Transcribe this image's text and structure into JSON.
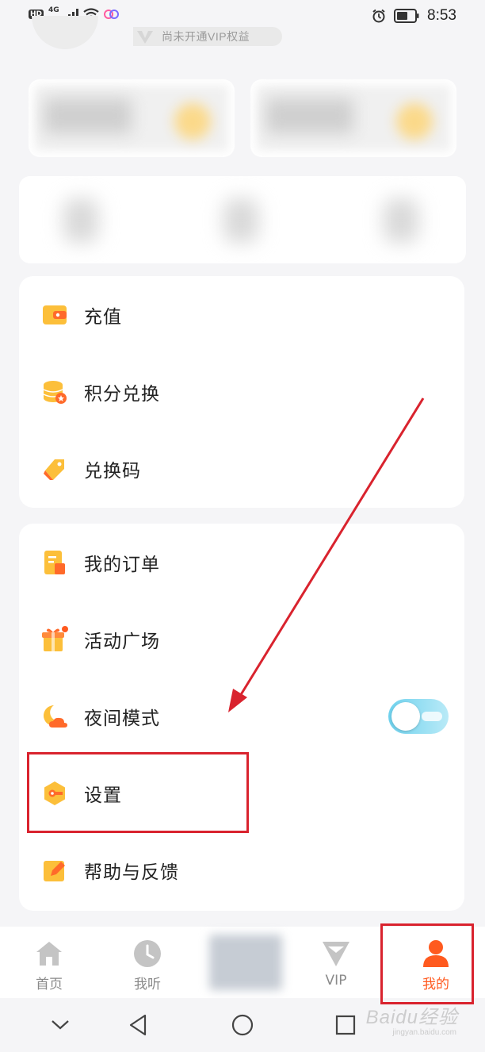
{
  "status_bar": {
    "hd": "HD",
    "network": "4G",
    "time": "8:53",
    "icons": [
      "signal-icon",
      "wifi-icon",
      "app-notification-icon",
      "alarm-icon",
      "battery-icon"
    ]
  },
  "header": {
    "vip_text": "尚未开通VIP权益"
  },
  "menu_group_1": [
    {
      "label": "充值",
      "icon": "wallet-icon"
    },
    {
      "label": "积分兑换",
      "icon": "coins-icon"
    },
    {
      "label": "兑换码",
      "icon": "tag-icon"
    }
  ],
  "menu_group_2": [
    {
      "label": "我的订单",
      "icon": "order-icon"
    },
    {
      "label": "活动广场",
      "icon": "gift-icon",
      "badge": true
    },
    {
      "label": "夜间模式",
      "icon": "moon-icon",
      "toggle": "off"
    },
    {
      "label": "设置",
      "icon": "settings-icon"
    },
    {
      "label": "帮助与反馈",
      "icon": "edit-icon"
    }
  ],
  "bottom_nav": [
    {
      "label": "首页",
      "icon": "home-icon",
      "active": false
    },
    {
      "label": "我听",
      "icon": "clock-icon",
      "active": false
    },
    {
      "label": "VIP",
      "icon": "vip-icon",
      "active": false
    },
    {
      "label": "我的",
      "icon": "profile-icon",
      "active": true
    }
  ],
  "colors": {
    "accent": "#ff5a1f",
    "icon_yellow": "#fcbf3a",
    "icon_orange": "#ff6a2a",
    "annotation_red": "#d9232e",
    "toggle_blue": "#6fd2ee"
  },
  "watermark": {
    "text": "Baidu经验",
    "sub": "jingyan.baidu.com"
  }
}
